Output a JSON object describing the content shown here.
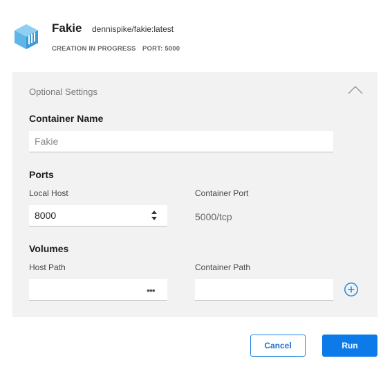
{
  "container": {
    "name": "Fakie",
    "image": "dennispike/fakie:latest",
    "status": "CREATION IN PROGRESS",
    "port": "PORT: 5000"
  },
  "optional_settings": {
    "title": "Optional Settings",
    "container_name": {
      "heading": "Container Name",
      "placeholder": "Fakie",
      "value": ""
    },
    "ports": {
      "heading": "Ports",
      "local_host_label": "Local Host",
      "local_host_value": "8000",
      "container_port_label": "Container Port",
      "container_port_value": "5000/tcp"
    },
    "volumes": {
      "heading": "Volumes",
      "host_path_label": "Host Path",
      "host_path_value": "",
      "browse_label": "•••",
      "container_path_label": "Container Path",
      "container_path_value": ""
    }
  },
  "actions": {
    "cancel_label": "Cancel",
    "run_label": "Run"
  },
  "colors": {
    "accent": "#0c7ae8",
    "logo": "#5eb6e8",
    "panel_bg": "#f2f2f2"
  },
  "icons": [
    "container-logo-icon",
    "chevron-up-icon",
    "stepper-icon",
    "ellipsis-icon",
    "add-circle-icon"
  ]
}
